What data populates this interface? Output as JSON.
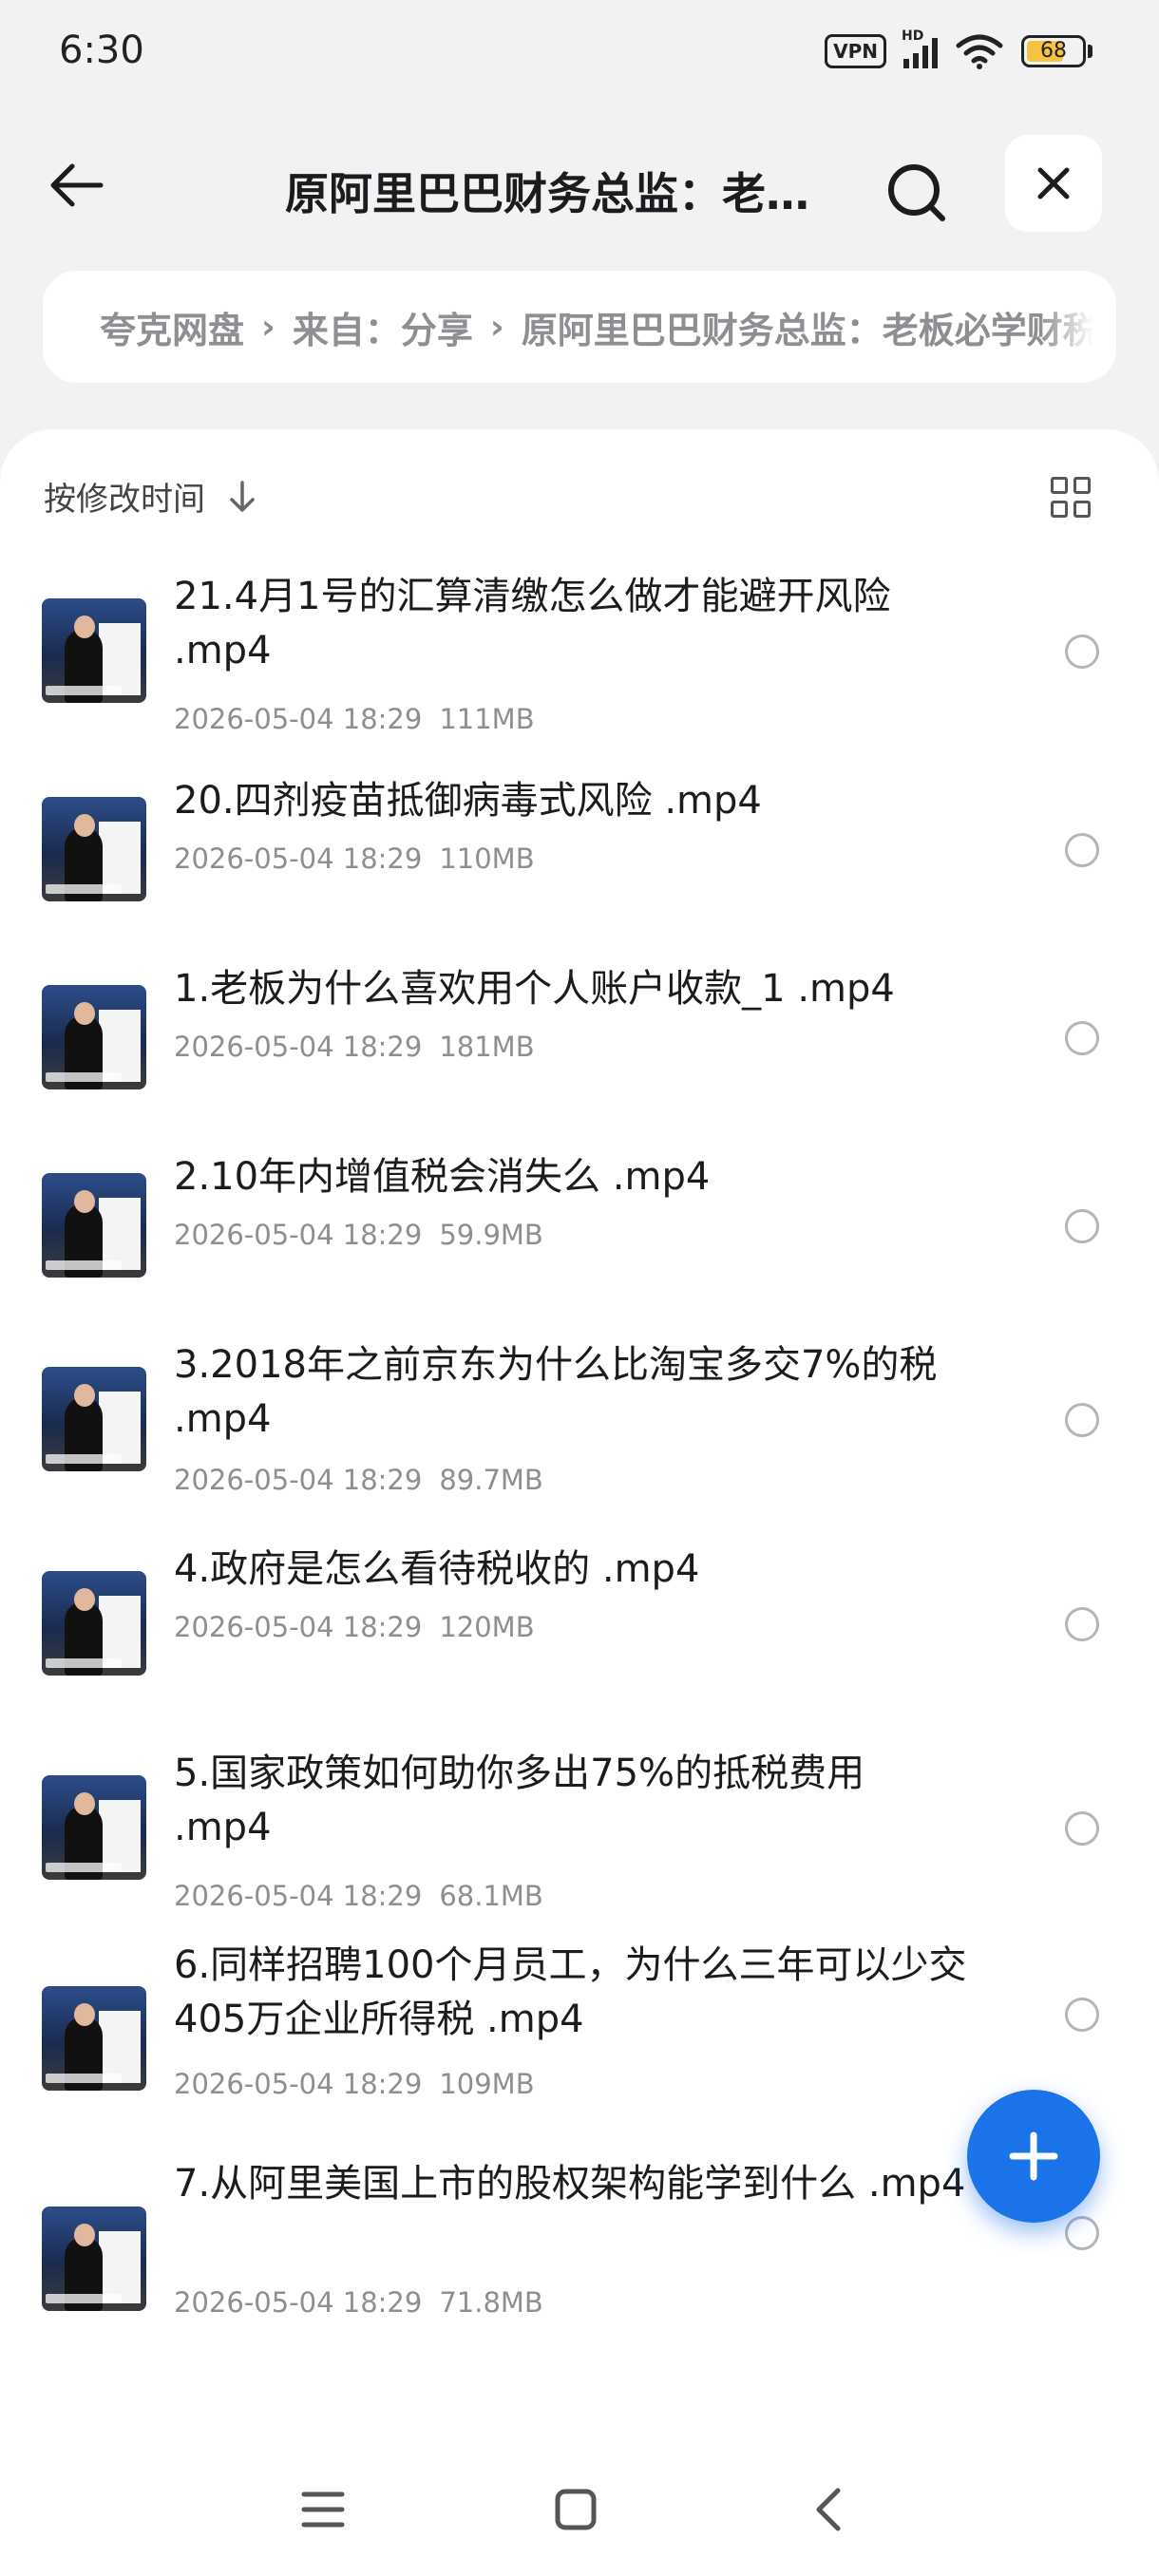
{
  "status_bar": {
    "time": "6:30",
    "vpn_label": "VPN",
    "network_label": "HD",
    "battery_level": "68",
    "battery_color": "#f5c242"
  },
  "header": {
    "title": "原阿里巴巴财务总监：老板必学财税课",
    "back_icon": "arrow-left-icon",
    "search_icon": "search-icon",
    "close_icon": "close-icon"
  },
  "breadcrumb": {
    "items": [
      "夸克网盘",
      "来自：分享",
      "原阿里巴巴财务总监：老板必学财税课"
    ]
  },
  "sort": {
    "label": "按修改时间",
    "direction_icon": "arrow-down-icon",
    "view_toggle_icon": "grid-view-icon"
  },
  "files": [
    {
      "name": "21.4月1号的汇算清缴怎么做才能避开风险 .mp4",
      "date": "2026-05-04 18:29",
      "size": "111MB"
    },
    {
      "name": "20.四剂疫苗抵御病毒式风险 .mp4",
      "date": "2026-05-04 18:29",
      "size": "110MB"
    },
    {
      "name": "1.老板为什么喜欢用个人账户收款_1 .mp4",
      "date": "2026-05-04 18:29",
      "size": "181MB"
    },
    {
      "name": "2.10年内增值税会消失么 .mp4",
      "date": "2026-05-04 18:29",
      "size": "59.9MB"
    },
    {
      "name": "3.2018年之前京东为什么比淘宝多交7%的税 .mp4",
      "date": "2026-05-04 18:29",
      "size": "89.7MB"
    },
    {
      "name": "4.政府是怎么看待税收的 .mp4",
      "date": "2026-05-04 18:29",
      "size": "120MB"
    },
    {
      "name": "5.国家政策如何助你多出75%的抵税费用 .mp4",
      "date": "2026-05-04 18:29",
      "size": "68.1MB"
    },
    {
      "name": "6.同样招聘100个月员工，为什么三年可以少交405万企业所得税 .mp4",
      "date": "2026-05-04 18:29",
      "size": "109MB"
    },
    {
      "name": "7.从阿里美国上市的股权架构能学到什么 .mp4",
      "date": "2026-05-04 18:29",
      "size": "71.8MB"
    }
  ],
  "fab": {
    "icon": "plus-icon",
    "color": "#1a73e8"
  },
  "nav_bar": {
    "menu_icon": "menu-icon",
    "home_icon": "home-square-icon",
    "back_icon": "back-chevron-icon"
  }
}
